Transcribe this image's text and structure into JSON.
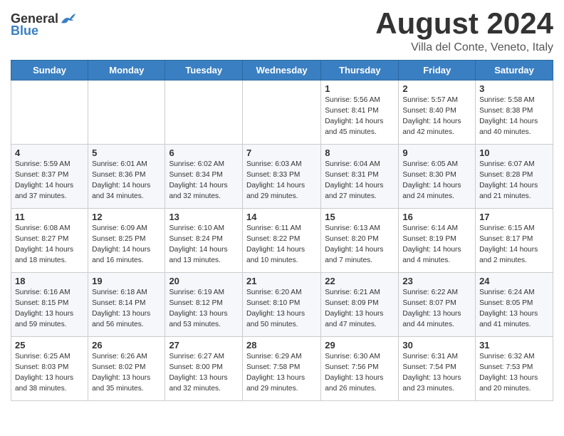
{
  "logo": {
    "general": "General",
    "blue": "Blue"
  },
  "title": "August 2024",
  "subtitle": "Villa del Conte, Veneto, Italy",
  "headers": [
    "Sunday",
    "Monday",
    "Tuesday",
    "Wednesday",
    "Thursday",
    "Friday",
    "Saturday"
  ],
  "weeks": [
    [
      {
        "day": "",
        "info": ""
      },
      {
        "day": "",
        "info": ""
      },
      {
        "day": "",
        "info": ""
      },
      {
        "day": "",
        "info": ""
      },
      {
        "day": "1",
        "info": "Sunrise: 5:56 AM\nSunset: 8:41 PM\nDaylight: 14 hours and 45 minutes."
      },
      {
        "day": "2",
        "info": "Sunrise: 5:57 AM\nSunset: 8:40 PM\nDaylight: 14 hours and 42 minutes."
      },
      {
        "day": "3",
        "info": "Sunrise: 5:58 AM\nSunset: 8:38 PM\nDaylight: 14 hours and 40 minutes."
      }
    ],
    [
      {
        "day": "4",
        "info": "Sunrise: 5:59 AM\nSunset: 8:37 PM\nDaylight: 14 hours and 37 minutes."
      },
      {
        "day": "5",
        "info": "Sunrise: 6:01 AM\nSunset: 8:36 PM\nDaylight: 14 hours and 34 minutes."
      },
      {
        "day": "6",
        "info": "Sunrise: 6:02 AM\nSunset: 8:34 PM\nDaylight: 14 hours and 32 minutes."
      },
      {
        "day": "7",
        "info": "Sunrise: 6:03 AM\nSunset: 8:33 PM\nDaylight: 14 hours and 29 minutes."
      },
      {
        "day": "8",
        "info": "Sunrise: 6:04 AM\nSunset: 8:31 PM\nDaylight: 14 hours and 27 minutes."
      },
      {
        "day": "9",
        "info": "Sunrise: 6:05 AM\nSunset: 8:30 PM\nDaylight: 14 hours and 24 minutes."
      },
      {
        "day": "10",
        "info": "Sunrise: 6:07 AM\nSunset: 8:28 PM\nDaylight: 14 hours and 21 minutes."
      }
    ],
    [
      {
        "day": "11",
        "info": "Sunrise: 6:08 AM\nSunset: 8:27 PM\nDaylight: 14 hours and 18 minutes."
      },
      {
        "day": "12",
        "info": "Sunrise: 6:09 AM\nSunset: 8:25 PM\nDaylight: 14 hours and 16 minutes."
      },
      {
        "day": "13",
        "info": "Sunrise: 6:10 AM\nSunset: 8:24 PM\nDaylight: 14 hours and 13 minutes."
      },
      {
        "day": "14",
        "info": "Sunrise: 6:11 AM\nSunset: 8:22 PM\nDaylight: 14 hours and 10 minutes."
      },
      {
        "day": "15",
        "info": "Sunrise: 6:13 AM\nSunset: 8:20 PM\nDaylight: 14 hours and 7 minutes."
      },
      {
        "day": "16",
        "info": "Sunrise: 6:14 AM\nSunset: 8:19 PM\nDaylight: 14 hours and 4 minutes."
      },
      {
        "day": "17",
        "info": "Sunrise: 6:15 AM\nSunset: 8:17 PM\nDaylight: 14 hours and 2 minutes."
      }
    ],
    [
      {
        "day": "18",
        "info": "Sunrise: 6:16 AM\nSunset: 8:15 PM\nDaylight: 13 hours and 59 minutes."
      },
      {
        "day": "19",
        "info": "Sunrise: 6:18 AM\nSunset: 8:14 PM\nDaylight: 13 hours and 56 minutes."
      },
      {
        "day": "20",
        "info": "Sunrise: 6:19 AM\nSunset: 8:12 PM\nDaylight: 13 hours and 53 minutes."
      },
      {
        "day": "21",
        "info": "Sunrise: 6:20 AM\nSunset: 8:10 PM\nDaylight: 13 hours and 50 minutes."
      },
      {
        "day": "22",
        "info": "Sunrise: 6:21 AM\nSunset: 8:09 PM\nDaylight: 13 hours and 47 minutes."
      },
      {
        "day": "23",
        "info": "Sunrise: 6:22 AM\nSunset: 8:07 PM\nDaylight: 13 hours and 44 minutes."
      },
      {
        "day": "24",
        "info": "Sunrise: 6:24 AM\nSunset: 8:05 PM\nDaylight: 13 hours and 41 minutes."
      }
    ],
    [
      {
        "day": "25",
        "info": "Sunrise: 6:25 AM\nSunset: 8:03 PM\nDaylight: 13 hours and 38 minutes."
      },
      {
        "day": "26",
        "info": "Sunrise: 6:26 AM\nSunset: 8:02 PM\nDaylight: 13 hours and 35 minutes."
      },
      {
        "day": "27",
        "info": "Sunrise: 6:27 AM\nSunset: 8:00 PM\nDaylight: 13 hours and 32 minutes."
      },
      {
        "day": "28",
        "info": "Sunrise: 6:29 AM\nSunset: 7:58 PM\nDaylight: 13 hours and 29 minutes."
      },
      {
        "day": "29",
        "info": "Sunrise: 6:30 AM\nSunset: 7:56 PM\nDaylight: 13 hours and 26 minutes."
      },
      {
        "day": "30",
        "info": "Sunrise: 6:31 AM\nSunset: 7:54 PM\nDaylight: 13 hours and 23 minutes."
      },
      {
        "day": "31",
        "info": "Sunrise: 6:32 AM\nSunset: 7:53 PM\nDaylight: 13 hours and 20 minutes."
      }
    ]
  ]
}
